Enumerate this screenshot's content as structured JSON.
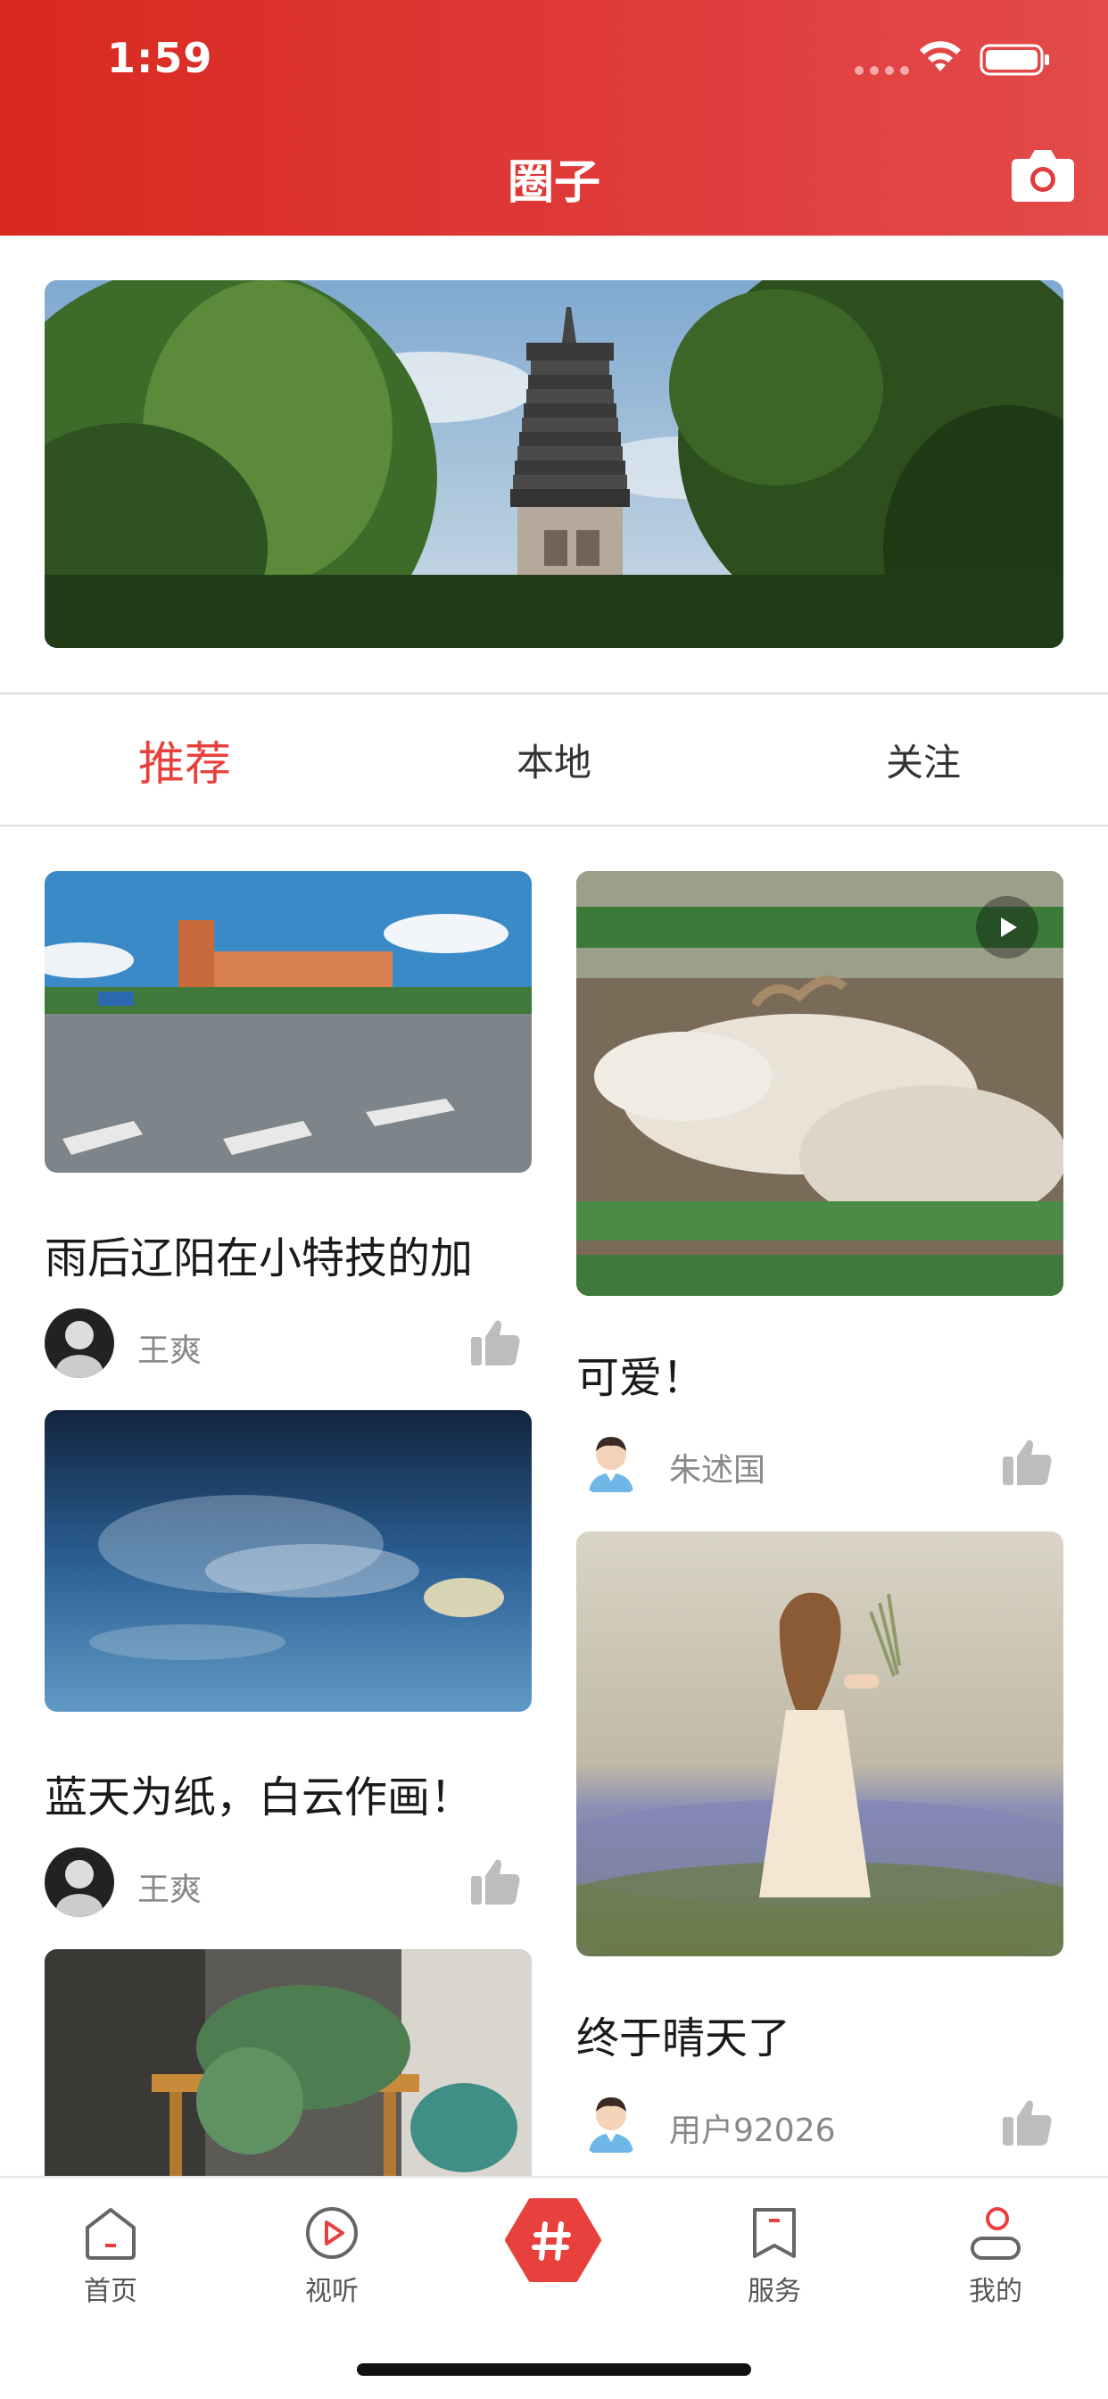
{
  "status_bar": {
    "time": "1:59"
  },
  "header": {
    "title": "圈子"
  },
  "tabs": [
    {
      "label": "推荐",
      "active": true
    },
    {
      "label": "本地",
      "active": false
    },
    {
      "label": "关注",
      "active": false
    }
  ],
  "feed": {
    "left": [
      {
        "title": "雨后辽阳在小特技的加",
        "author": "王爽"
      },
      {
        "title": "蓝天为纸，白云作画！",
        "author": "王爽"
      }
    ],
    "right": [
      {
        "title": "可爱！",
        "author": "朱述国"
      },
      {
        "title": "终于晴天了",
        "author": "用户92026"
      }
    ]
  },
  "bottom_nav": [
    {
      "label": "首页",
      "icon": "home-icon"
    },
    {
      "label": "视听",
      "icon": "play-circle-icon"
    },
    {
      "label": "",
      "icon": "hashtag-icon"
    },
    {
      "label": "服务",
      "icon": "bookmark-icon"
    },
    {
      "label": "我的",
      "icon": "user-icon"
    }
  ],
  "colors": {
    "accent": "#e8413d",
    "header": "#dd3430"
  }
}
